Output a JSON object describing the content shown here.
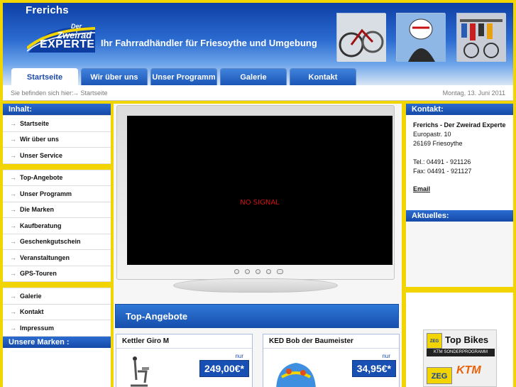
{
  "header": {
    "brand": "Frerichs",
    "logo_der": "Der",
    "logo_zweirad": "Zweirad",
    "logo_experte": "EXPERTE",
    "tagline": "Ihr Fahrradhändler für Friesoythe und Umgebung"
  },
  "tabs": [
    {
      "label": "Startseite",
      "active": true
    },
    {
      "label": "Wir über uns",
      "active": false
    },
    {
      "label": "Unser Programm",
      "active": false
    },
    {
      "label": "Galerie",
      "active": false
    },
    {
      "label": "Kontakt",
      "active": false
    }
  ],
  "breadcrumb": {
    "label": "Sie befinden sich hier:",
    "current": "Startseite",
    "date": "Montag, 13. Juni 2011"
  },
  "leftnav": {
    "title": "Inhalt:",
    "group1": [
      "Startseite",
      "Wir über uns",
      "Unser Service"
    ],
    "group2": [
      "Top-Angebote",
      "Unser Programm",
      "Die Marken",
      "Kaufberatung",
      "Geschenkgutschein",
      "Veranstaltungen",
      "GPS-Touren"
    ],
    "group3": [
      "Galerie",
      "Kontakt",
      "Impressum"
    ],
    "brands_title": "Unsere Marken :"
  },
  "center": {
    "tv_text": "NO SIGNAL",
    "offers_title": "Top-Angebote",
    "products": [
      {
        "name": "Kettler Giro M",
        "nur": "nur",
        "price": "249,00€*"
      },
      {
        "name": "KED Bob der Baumeister",
        "nur": "nur",
        "price": "34,95€*"
      }
    ]
  },
  "rightcol": {
    "contact_title": "Kontakt:",
    "company": "Frerichs - Der Zweirad Experte",
    "street": "Europastr. 10",
    "city": "26169 Friesoythe",
    "tel": "Tel.: 04491 - 921126",
    "fax": "Fax: 04491 - 921127",
    "email": "Email",
    "news_title": "Aktuelles:"
  },
  "banner": {
    "title": "Top Bikes",
    "zeg": "ZEG",
    "subtitle": "KTM SONDERPROGRAMM",
    "ktm": "KTM",
    "zeg2": "ZEG"
  }
}
